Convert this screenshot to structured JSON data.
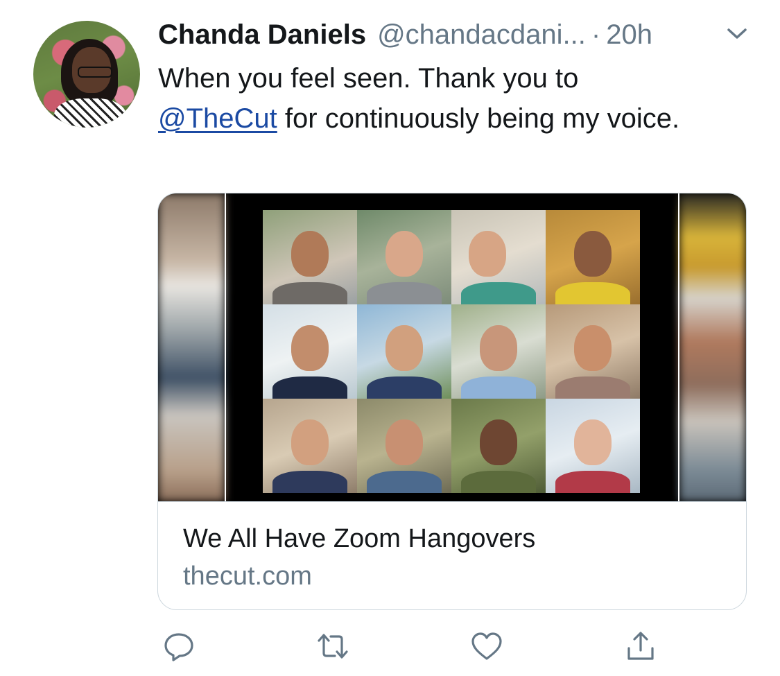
{
  "tweet": {
    "author": {
      "name": "Chanda Daniels",
      "handle": "@chandacdani...",
      "separator": "·",
      "time": "20h"
    },
    "text": {
      "part1": "When you feel seen. Thank you to",
      "mention": "@TheCut",
      "part2": " for continuously being my voice."
    },
    "card": {
      "title": "We All Have Zoom Hangovers",
      "domain": "thecut.com"
    },
    "icons": {
      "menu": "chevron-down-icon",
      "reply": "reply-icon",
      "retweet": "retweet-icon",
      "like": "heart-icon",
      "share": "share-icon"
    },
    "colors": {
      "text": "#14171a",
      "secondary": "#657786",
      "link": "#1b4aa3",
      "border": "#ccd6dd"
    }
  }
}
